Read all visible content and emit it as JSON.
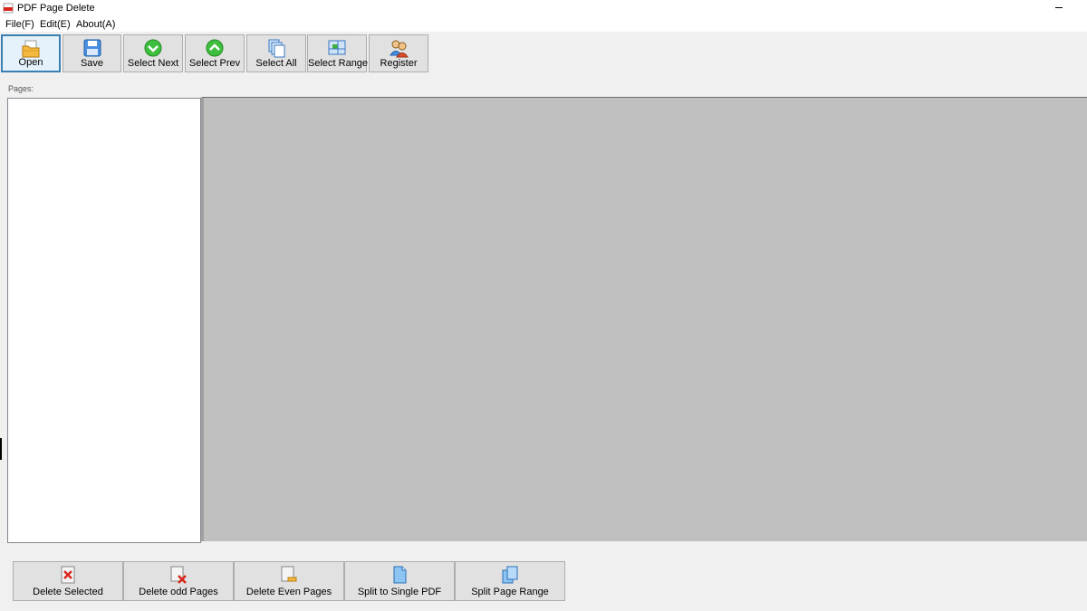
{
  "window": {
    "title": "PDF Page Delete"
  },
  "menu": {
    "items": [
      "File(F)",
      "Edit(E)",
      "About(A)"
    ]
  },
  "toolbar": {
    "buttons": [
      {
        "label": "Open",
        "icon": "folder-open-icon"
      },
      {
        "label": "Save",
        "icon": "floppy-disk-icon"
      },
      {
        "label": "Select Next",
        "icon": "green-down-arrow-icon"
      },
      {
        "label": "Select Prev",
        "icon": "green-up-arrow-icon"
      },
      {
        "label": "Select All",
        "icon": "stacked-pages-icon"
      },
      {
        "label": "Select Range",
        "icon": "range-grid-icon"
      },
      {
        "label": "Register",
        "icon": "users-icon"
      }
    ]
  },
  "pages_panel": {
    "label": "Pages:"
  },
  "actions": {
    "buttons": [
      {
        "label": "Delete Selected",
        "icon": "delete-page-icon"
      },
      {
        "label": "Delete odd Pages",
        "icon": "delete-odd-pages-icon"
      },
      {
        "label": "Delete Even Pages",
        "icon": "delete-even-pages-icon"
      },
      {
        "label": "Split to Single PDF",
        "icon": "split-single-icon"
      },
      {
        "label": "Split Page Range",
        "icon": "split-range-icon"
      }
    ]
  },
  "colors": {
    "toolbar_bg": "#f0f0f0",
    "preview_bg": "#c0c0c0",
    "active_border": "#3c7fb1"
  }
}
